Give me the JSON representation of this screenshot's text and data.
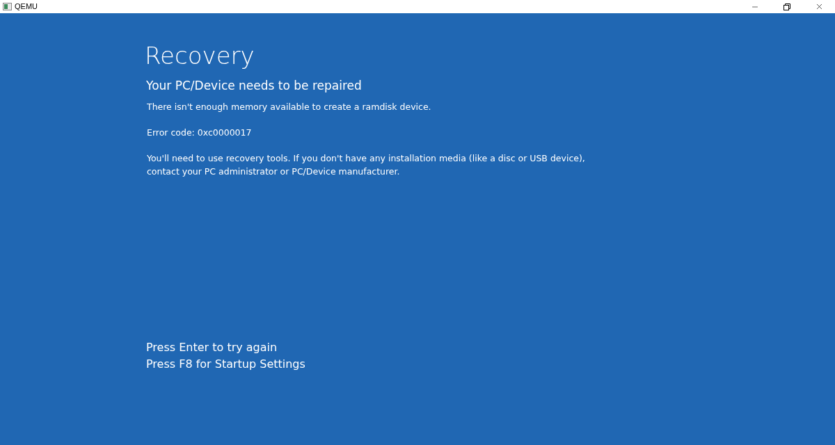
{
  "window": {
    "title": "QEMU"
  },
  "screen": {
    "heading": "Recovery",
    "subheading": "Your PC/Device needs to be repaired",
    "paragraphs": [
      "There isn't enough memory available to create a ramdisk device.",
      "Error code: 0xc0000017",
      "You'll need to use recovery tools. If you don't have any installation media (like a disc or USB device), contact your PC administrator or PC/Device manufacturer."
    ],
    "prompts": [
      "Press Enter to try again",
      "Press F8 for Startup Settings"
    ]
  }
}
